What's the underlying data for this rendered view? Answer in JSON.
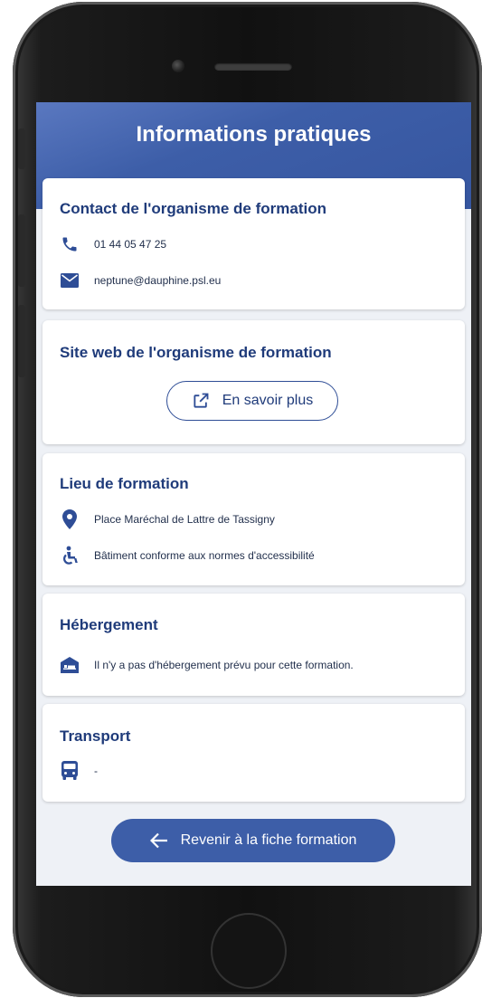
{
  "header": {
    "title": "Informations pratiques"
  },
  "contact": {
    "title": "Contact de l'organisme de formation",
    "phone": "01 44 05 47 25",
    "email": "neptune@dauphine.psl.eu"
  },
  "website": {
    "title": "Site web de l'organisme de formation",
    "button_label": "En savoir plus"
  },
  "location": {
    "title": "Lieu de formation",
    "address": "Place Maréchal de Lattre de Tassigny",
    "accessibility": "Bâtiment conforme aux normes d'accessibilité"
  },
  "accommodation": {
    "title": "Hébergement",
    "text": "Il n'y a pas d'hébergement prévu pour cette formation."
  },
  "transport": {
    "title": "Transport",
    "text": "-"
  },
  "footer": {
    "back_label": "Revenir à la fiche formation"
  },
  "colors": {
    "primary": "#3d5ea8",
    "title": "#1f3b7a",
    "background": "#eef1f6"
  },
  "icons": [
    "phone-icon",
    "mail-icon",
    "external-link-icon",
    "location-pin-icon",
    "wheelchair-icon",
    "hotel-icon",
    "bus-icon",
    "arrow-left-icon"
  ]
}
